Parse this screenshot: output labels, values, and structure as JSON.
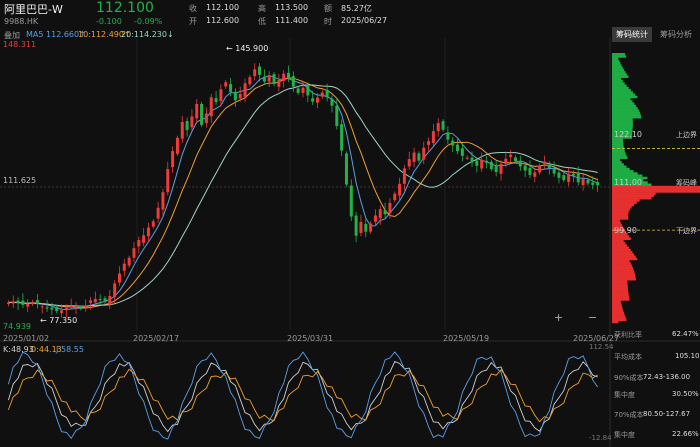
{
  "stock": {
    "name": "阿里巴巴-W",
    "code": "9988.HK",
    "price": "112.100",
    "change": "-0.100",
    "change_pct": "-0.09%"
  },
  "quote": {
    "close_label": "收",
    "close": "112.100",
    "high_label": "高",
    "high": "113.500",
    "amount_label": "额",
    "amount": "85.27亿",
    "open_label": "开",
    "open": "112.600",
    "low_label": "低",
    "low": "111.400",
    "time_label": "时",
    "time": "2025/06/27"
  },
  "overlay_label": "叠加",
  "ma_legend": {
    "ma5": "MA5 112.660↑",
    "ma10": "10:112.490↑",
    "ma20": "20:114.230↓"
  },
  "colors": {
    "up": "#ef3b3b",
    "down": "#23b24a",
    "ma5": "#5aa0e6",
    "ma10": "#f0a030",
    "ma20": "#9fd3c8",
    "bg": "#101010"
  },
  "panel": {
    "tab_active": "筹码统计",
    "tab_other": "筹码分析"
  },
  "chart_data": {
    "type": "candlestick",
    "ylim": [
      74.939,
      148.311
    ],
    "y_axis_labels": {
      "top": "148.311",
      "mid": "111.625",
      "bottom": "74.939"
    },
    "x_tick_labels": [
      "2025/01/02",
      "2025/02/17",
      "2025/03/31",
      "2025/05/19",
      "2025/06/27"
    ],
    "annotations": [
      {
        "text": "← 145.900",
        "value": 145.9
      },
      {
        "text": "← 77.350",
        "value": 77.35
      }
    ],
    "close": [
      80.2,
      80.5,
      80.0,
      79.6,
      79.9,
      80.4,
      79.8,
      79.2,
      78.6,
      78.3,
      77.9,
      78.1,
      78.8,
      79.3,
      79.0,
      78.7,
      79.4,
      80.8,
      81.2,
      80.9,
      80.4,
      82.0,
      85.4,
      88.1,
      90.8,
      92.4,
      95.0,
      97.2,
      98.5,
      100.6,
      102.3,
      106.0,
      110.2,
      116.5,
      121.4,
      125.0,
      129.3,
      127.1,
      130.8,
      134.2,
      128.5,
      131.6,
      136.0,
      134.7,
      138.2,
      140.1,
      137.5,
      135.2,
      136.9,
      139.8,
      141.5,
      143.6,
      142.1,
      140.3,
      141.8,
      139.6,
      140.7,
      142.4,
      141.0,
      138.9,
      137.2,
      138.6,
      136.5,
      134.8,
      135.9,
      137.3,
      136.1,
      133.7,
      128.2,
      121.5,
      112.3,
      103.6,
      98.4,
      102.1,
      99.5,
      101.7,
      103.9,
      105.6,
      104.2,
      107.3,
      109.8,
      112.5,
      116.7,
      119.2,
      121.0,
      118.8,
      122.3,
      124.1,
      126.8,
      129.0,
      127.2,
      124.5,
      122.9,
      121.4,
      120.1,
      119.6,
      118.3,
      117.4,
      119.0,
      118.2,
      116.5,
      115.7,
      117.9,
      119.3,
      120.4,
      118.7,
      117.2,
      116.1,
      114.9,
      115.6,
      117.4,
      118.5,
      116.8,
      115.3,
      114.1,
      113.5,
      115.2,
      114.7,
      112.9,
      113.8,
      112.6,
      112.2,
      112.1
    ],
    "high": 148.311,
    "low": 74.939,
    "oscillator": {
      "labels": {
        "k": "K:48.93",
        "d": "D:44.13",
        "j": "J:58.55"
      },
      "ylim": [
        -12.84,
        112.54
      ]
    },
    "chip_stats": {
      "upper_label": "上边界",
      "upper": "122.10",
      "peak_label": "筹码峰",
      "peak": "111.00",
      "lower_label": "下边界",
      "lower": "99.90",
      "profit_ratio_label": "获利比率",
      "profit_ratio": "62.47%",
      "avg_cost_label": "平均成本",
      "avg_cost": "105.10",
      "cost90_label": "90%成本",
      "cost90": "72.43-136.00",
      "conc90_label": "集中度",
      "conc90": "30.50%",
      "cost70_label": "70%成本",
      "cost70": "80.50-127.67",
      "conc70_label": "集中度",
      "conc70": "22.66%"
    }
  }
}
